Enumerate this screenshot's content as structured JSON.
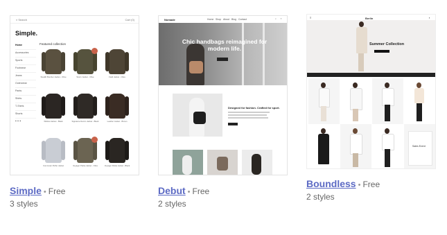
{
  "themes": [
    {
      "name": "Simple",
      "price": "Free",
      "styles": "3 styles",
      "preview": {
        "logo": "Simple.",
        "search": "Search",
        "cart": "Cart (0)",
        "sidebar": [
          "Home",
          "Accessories",
          "Sports",
          "Footwear",
          "Jeans",
          "Outerwear",
          "Pants",
          "Shirts",
          "T-Shirts",
          "Shorts"
        ],
        "section_title": "Featured collection",
        "products": [
          {
            "caption": "Stealth Bomber Jacket - Olive"
          },
          {
            "caption": "Storm Jacket - Olive"
          },
          {
            "caption": "Field Jacket - Olive"
          },
          {
            "caption": "Wildcat Jacket - Black"
          },
          {
            "caption": "Signature Denim Jacket - Black"
          },
          {
            "caption": "Leather Jacket - Brown"
          },
          {
            "caption": "Commuter Puffer Jacket"
          },
          {
            "caption": "Voyager Parka Jacket - Olive"
          },
          {
            "caption": "Voyager Parka Jacket - Black"
          }
        ]
      }
    },
    {
      "name": "Debut",
      "price": "Free",
      "styles": "2 styles",
      "preview": {
        "logo": "Nomade",
        "nav": [
          "Home",
          "Shop",
          "About",
          "Blog",
          "Contact"
        ],
        "hero_text": "Chic handbags reimagined for modern life.",
        "feature_title": "Designed for fashion. Crafted for sport."
      }
    },
    {
      "name": "Boundless",
      "price": "Free",
      "styles": "2 styles",
      "preview": {
        "logo": "Berlin",
        "hero_text": "Summer Collection",
        "sale_text": "Sales Event"
      }
    }
  ],
  "colors": {
    "link": "#5c6ac4",
    "muted": "#666666"
  }
}
